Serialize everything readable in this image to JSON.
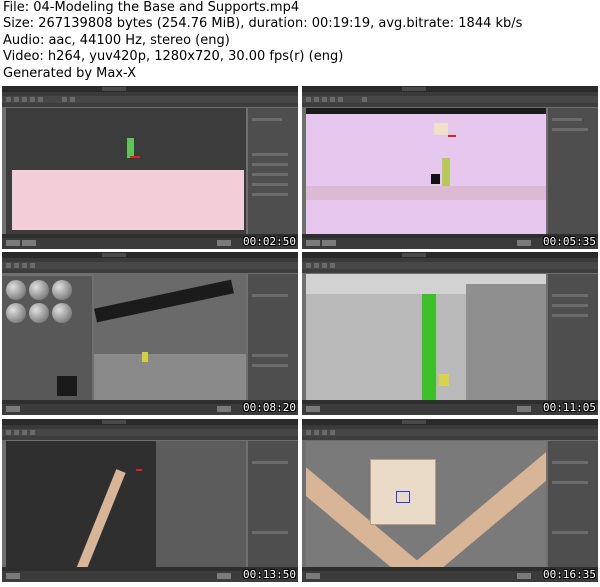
{
  "header": {
    "file": "File: 04-Modeling the Base and Supports.mp4",
    "size": "Size: 267139808 bytes (254.76 MiB), duration: 00:19:19, avg.bitrate: 1844 kb/s",
    "audio": "Audio: aac, 44100 Hz, stereo (eng)",
    "video": "Video: h264, yuv420p, 1280x720, 30.00 fps(r) (eng)",
    "generated": "Generated by Max-X"
  },
  "thumbnails": [
    {
      "timestamp": "00:02:50",
      "scene": "pink ground plane with small green column"
    },
    {
      "timestamp": "00:05:35",
      "scene": "lavender backdrop with yellow-green pillar"
    },
    {
      "timestamp": "00:08:20",
      "scene": "material editor with sphere slots and beam"
    },
    {
      "timestamp": "00:11:05",
      "scene": "green vertical support against gray walls"
    },
    {
      "timestamp": "00:13:50",
      "scene": "dark viewport with diagonal wooden leg"
    },
    {
      "timestamp": "00:16:35",
      "scene": "crossed wooden legs with square plate"
    }
  ],
  "colors": {
    "app_dark": "#2a2a2a",
    "panel": "#4e4e4e",
    "pink_plane": "#f2cfd8",
    "lavender": "#e6c8ef",
    "green_support": "#3dbf2a",
    "wood": "#d9b597"
  }
}
